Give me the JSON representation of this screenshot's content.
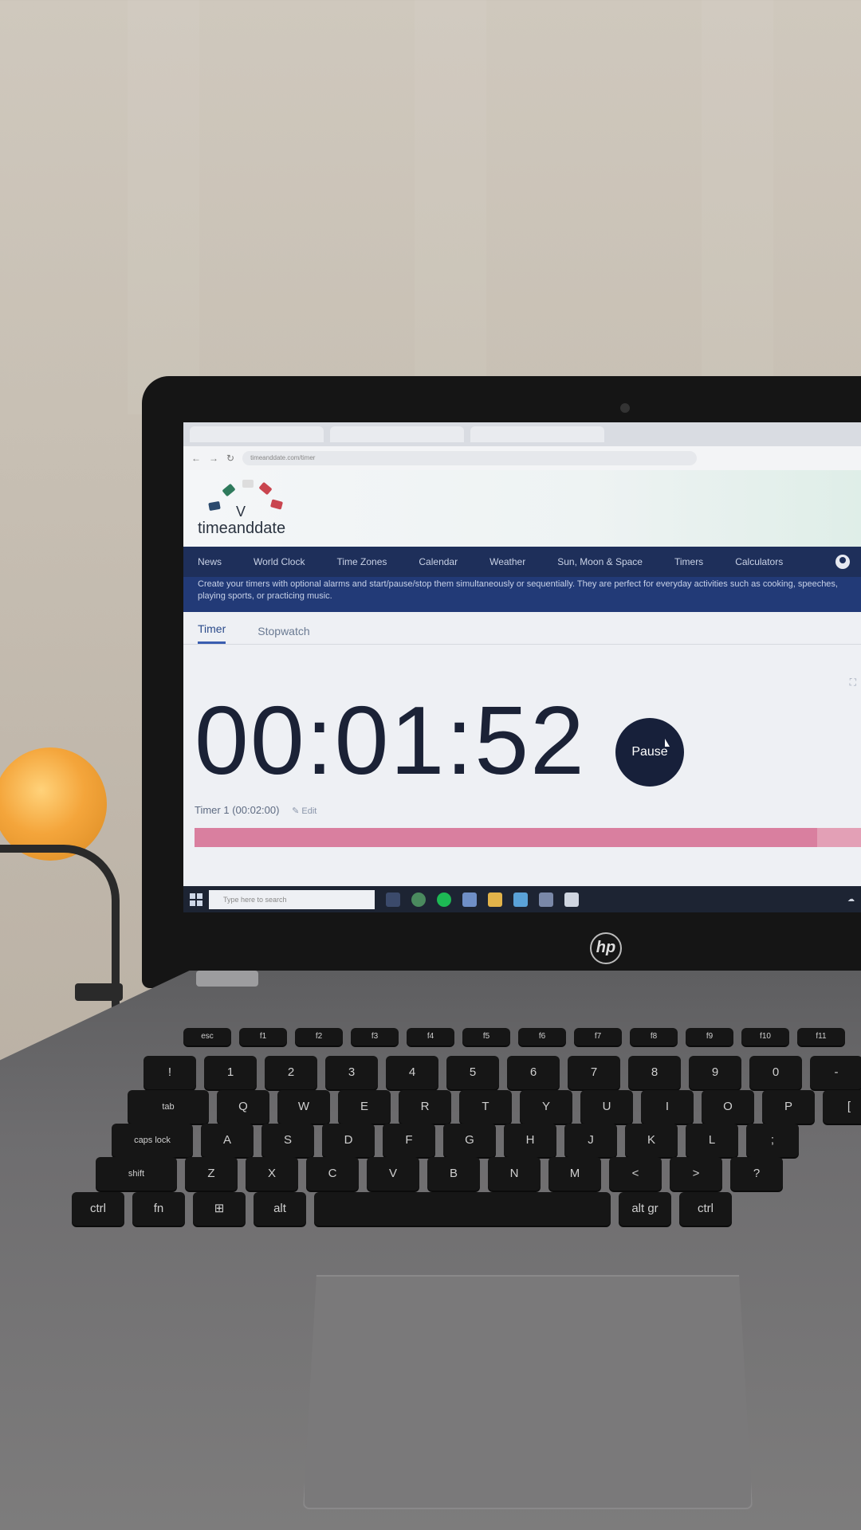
{
  "browser": {
    "tabs": [
      "",
      "",
      ""
    ],
    "url": "timeanddate.com/timer"
  },
  "site": {
    "logo": "timeanddate",
    "nav": [
      "News",
      "World Clock",
      "Time Zones",
      "Calendar",
      "Weather",
      "Sun, Moon & Space",
      "Timers",
      "Calculators"
    ],
    "intro": "Create your timers with optional alarms and start/pause/stop them simultaneously or sequentially. They are perfect for everyday activities such as cooking, speeches, playing sports, or practicing music.",
    "subtabs": [
      "Timer",
      "Stopwatch"
    ],
    "active_subtab": "Timer"
  },
  "timer": {
    "display": "00:01:52",
    "pause_label": "Pause",
    "label": "Timer 1 (00:02:00)",
    "edit_label": "Edit",
    "progress_remaining": 0.93
  },
  "taskbar": {
    "search_placeholder": "Type here to search"
  },
  "keyboard": {
    "row1": [
      "esc",
      "f1",
      "f2",
      "f3",
      "f4",
      "f5",
      "f6",
      "f7",
      "f8",
      "f9",
      "f10",
      "f11"
    ],
    "row2": [
      "!",
      "1",
      "2",
      "3",
      "4",
      "5",
      "6",
      "7",
      "8",
      "9",
      "0",
      "-"
    ],
    "row3": [
      "tab",
      "Q",
      "W",
      "E",
      "R",
      "T",
      "Y",
      "U",
      "I",
      "O",
      "P",
      "["
    ],
    "row4": [
      "caps lock",
      "A",
      "S",
      "D",
      "F",
      "G",
      "H",
      "J",
      "K",
      "L",
      ";"
    ],
    "row5": [
      "shift",
      "Z",
      "X",
      "C",
      "V",
      "B",
      "N",
      "M",
      "<",
      ">",
      "?"
    ],
    "row6": [
      "ctrl",
      "fn",
      "⊞",
      "alt",
      "",
      "alt gr",
      "ctrl"
    ]
  },
  "colors": {
    "nav_bg": "#1e2f5a",
    "timer_text": "#1b2236",
    "progress": "#d97f9f"
  }
}
